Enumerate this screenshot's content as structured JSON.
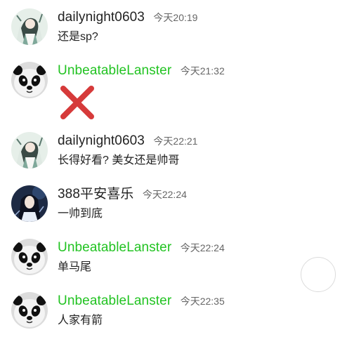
{
  "colors": {
    "vip_name": "#22c322",
    "normal_name": "#222222",
    "time": "#666666",
    "cross": "#d63a3a"
  },
  "messages": [
    {
      "user": "dailynight0603",
      "time": "今天20:19",
      "text": "还是sp?",
      "avatar_icon": "anime-character-avatar-icon",
      "vip": false
    },
    {
      "user": "UnbeatableLanster",
      "time": "今天21:32",
      "text": "",
      "image": "red-cross-icon",
      "avatar_icon": "panda-avatar-icon",
      "vip": true
    },
    {
      "user": "dailynight0603",
      "time": "今天22:21",
      "text": "长得好看? 美女还是帅哥",
      "avatar_icon": "anime-character-avatar-icon",
      "vip": false
    },
    {
      "user": "388平安喜乐",
      "time": "今天22:24",
      "text": "一帅到底",
      "avatar_icon": "dark-anime-avatar-icon",
      "vip": false
    },
    {
      "user": "UnbeatableLanster",
      "time": "今天22:24",
      "text": "单马尾",
      "avatar_icon": "panda-avatar-icon",
      "vip": true
    },
    {
      "user": "UnbeatableLanster",
      "time": "今天22:35",
      "text": "人家有箭",
      "avatar_icon": "panda-avatar-icon",
      "vip": true
    }
  ]
}
